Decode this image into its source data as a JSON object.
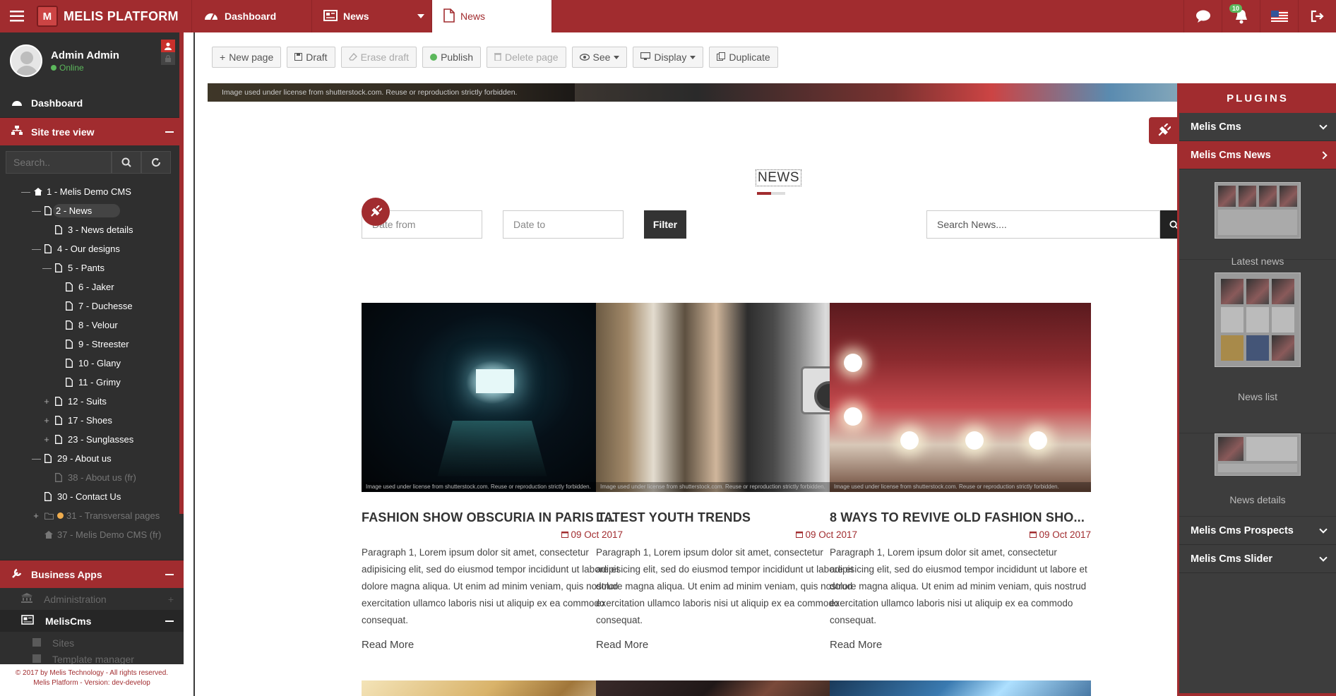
{
  "app": {
    "brand": "MELIS PLATFORM",
    "logo_letter": "M"
  },
  "tabs": [
    {
      "label": "Dashboard",
      "icon": "dashboard-icon"
    },
    {
      "label": "News",
      "icon": "newspaper-icon"
    },
    {
      "label": "News",
      "icon": "page-icon"
    }
  ],
  "topbar_icons": {
    "notification_count": "10"
  },
  "user": {
    "name": "Admin Admin",
    "status": "Online"
  },
  "sidebar": {
    "dashboard": "Dashboard",
    "site_tree": "Site tree view",
    "search_placeholder": "Search..",
    "tree": [
      {
        "label": "1 - Melis Demo CMS",
        "toggle": "—",
        "level": 0,
        "icon": "home-icon"
      },
      {
        "label": "2 - News",
        "toggle": "—",
        "level": 1,
        "icon": "page-icon",
        "selected": true
      },
      {
        "label": "3 - News details",
        "toggle": "",
        "level": 2,
        "icon": "page-icon"
      },
      {
        "label": "4 - Our designs",
        "toggle": "—",
        "level": 1,
        "icon": "page-icon"
      },
      {
        "label": "5 - Pants",
        "toggle": "—",
        "level": 2,
        "icon": "page-icon"
      },
      {
        "label": "6 - Jaker",
        "toggle": "",
        "level": 3,
        "icon": "page-icon"
      },
      {
        "label": "7 - Duchesse",
        "toggle": "",
        "level": 3,
        "icon": "page-icon"
      },
      {
        "label": "8 - Velour",
        "toggle": "",
        "level": 3,
        "icon": "page-icon"
      },
      {
        "label": "9 - Streester",
        "toggle": "",
        "level": 3,
        "icon": "page-icon"
      },
      {
        "label": "10 - Glany",
        "toggle": "",
        "level": 3,
        "icon": "page-icon"
      },
      {
        "label": "11 - Grimy",
        "toggle": "",
        "level": 3,
        "icon": "page-icon"
      },
      {
        "label": "12 - Suits",
        "toggle": "+",
        "level": 2,
        "icon": "page-icon"
      },
      {
        "label": "17 - Shoes",
        "toggle": "+",
        "level": 2,
        "icon": "page-icon"
      },
      {
        "label": "23 - Sunglasses",
        "toggle": "+",
        "level": 2,
        "icon": "page-icon"
      },
      {
        "label": "29 - About us",
        "toggle": "—",
        "level": 1,
        "icon": "page-icon"
      },
      {
        "label": "38 - About us (fr)",
        "toggle": "",
        "level": 2,
        "icon": "page-icon",
        "dim": true
      },
      {
        "label": "30 - Contact Us",
        "toggle": "",
        "level": 1,
        "icon": "page-icon"
      },
      {
        "label": "31 - Transversal pages",
        "toggle": "+",
        "level": 1,
        "icon": "folder-icon",
        "dim": true,
        "dot": true
      },
      {
        "label": "37 - Melis Demo CMS (fr)",
        "toggle": "",
        "level": 1,
        "icon": "home-icon",
        "dim": true
      }
    ],
    "business_apps": "Business Apps",
    "administration": "Administration",
    "meliscms": "MelisCms",
    "sites": "Sites",
    "template_manager": "Template manager",
    "copyright_line1": "© 2017 by Melis Technology - All rights reserved.",
    "copyright_line2": "Melis Platform - Version: dev-develop"
  },
  "toolbar": {
    "new_page": "New page",
    "draft": "Draft",
    "erase_draft": "Erase draft",
    "publish": "Publish",
    "delete_page": "Delete page",
    "see": "See",
    "display": "Display",
    "duplicate": "Duplicate"
  },
  "page": {
    "banner_caption": "Image used under license from shutterstock.com. Reuse or reproduction strictly forbidden.",
    "title": "NEWS",
    "date_from_placeholder": "Date from",
    "date_to_placeholder": "Date to",
    "filter_label": "Filter",
    "search_placeholder": "Search News....",
    "img_caption": "Image used under license from shutterstock.com. Reuse or reproduction strictly forbidden.",
    "read_more": "Read More",
    "articles": [
      {
        "title": "FASHION SHOW OBSCURIA IN PARIS T...",
        "date": "09 Oct 2017",
        "text": "Paragraph 1, Lorem ipsum dolor sit amet, consectetur adipisicing elit, sed do eiusmod tempor incididunt ut labore et dolore magna aliqua. Ut enim ad minim veniam, quis nostrud exercitation ullamco laboris nisi ut aliquip ex ea commodo consequat."
      },
      {
        "title": "LATEST YOUTH TRENDS",
        "date": "09 Oct 2017",
        "text": "Paragraph 1, Lorem ipsum dolor sit amet, consectetur adipisicing elit, sed do eiusmod tempor incididunt ut labore et dolore magna aliqua. Ut enim ad minim veniam, quis nostrud exercitation ullamco laboris nisi ut aliquip ex ea commodo consequat."
      },
      {
        "title": "8 WAYS TO REVIVE OLD FASHION SHO...",
        "date": "09 Oct 2017",
        "text": "Paragraph 1, Lorem ipsum dolor sit amet, consectetur adipisicing elit, sed do eiusmod tempor incididunt ut labore et dolore magna aliqua. Ut enim ad minim veniam, quis nostrud exercitation ullamco laboris nisi ut aliquip ex ea commodo consequat."
      }
    ]
  },
  "plugins": {
    "header": "PLUGINS",
    "melis_cms": "Melis Cms",
    "melis_cms_news": "Melis Cms News",
    "latest_news": "Latest news",
    "news_list": "News list",
    "news_details": "News details",
    "melis_cms_prospects": "Melis Cms Prospects",
    "melis_cms_slider": "Melis Cms Slider"
  },
  "colors": {
    "accent": "#a12c2f",
    "sidebar": "#2f2f2f",
    "online": "#5cb85c"
  }
}
